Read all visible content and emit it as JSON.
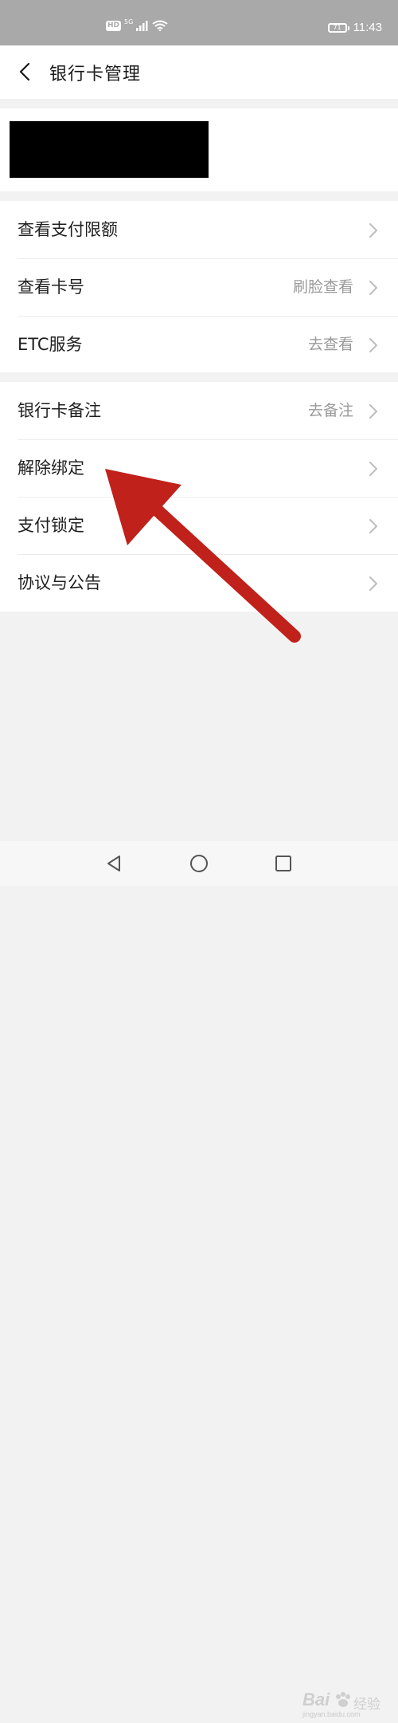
{
  "status_bar": {
    "hd": "HD",
    "network": "5G",
    "battery": "71",
    "time": "11:43"
  },
  "header": {
    "title": "银行卡管理"
  },
  "group1": [
    {
      "label": "查看支付限额",
      "value": ""
    },
    {
      "label": "查看卡号",
      "value": "刷脸查看"
    },
    {
      "label": "ETC服务",
      "value": "去查看"
    }
  ],
  "group2": [
    {
      "label": "银行卡备注",
      "value": "去备注"
    },
    {
      "label": "解除绑定",
      "value": ""
    },
    {
      "label": "支付锁定",
      "value": ""
    },
    {
      "label": "协议与公告",
      "value": ""
    }
  ],
  "annotation": {
    "arrow_color": "#c0211b"
  },
  "watermark": {
    "main": "Bai",
    "tail": "经验",
    "sub": "jingyan.baidu.com"
  }
}
